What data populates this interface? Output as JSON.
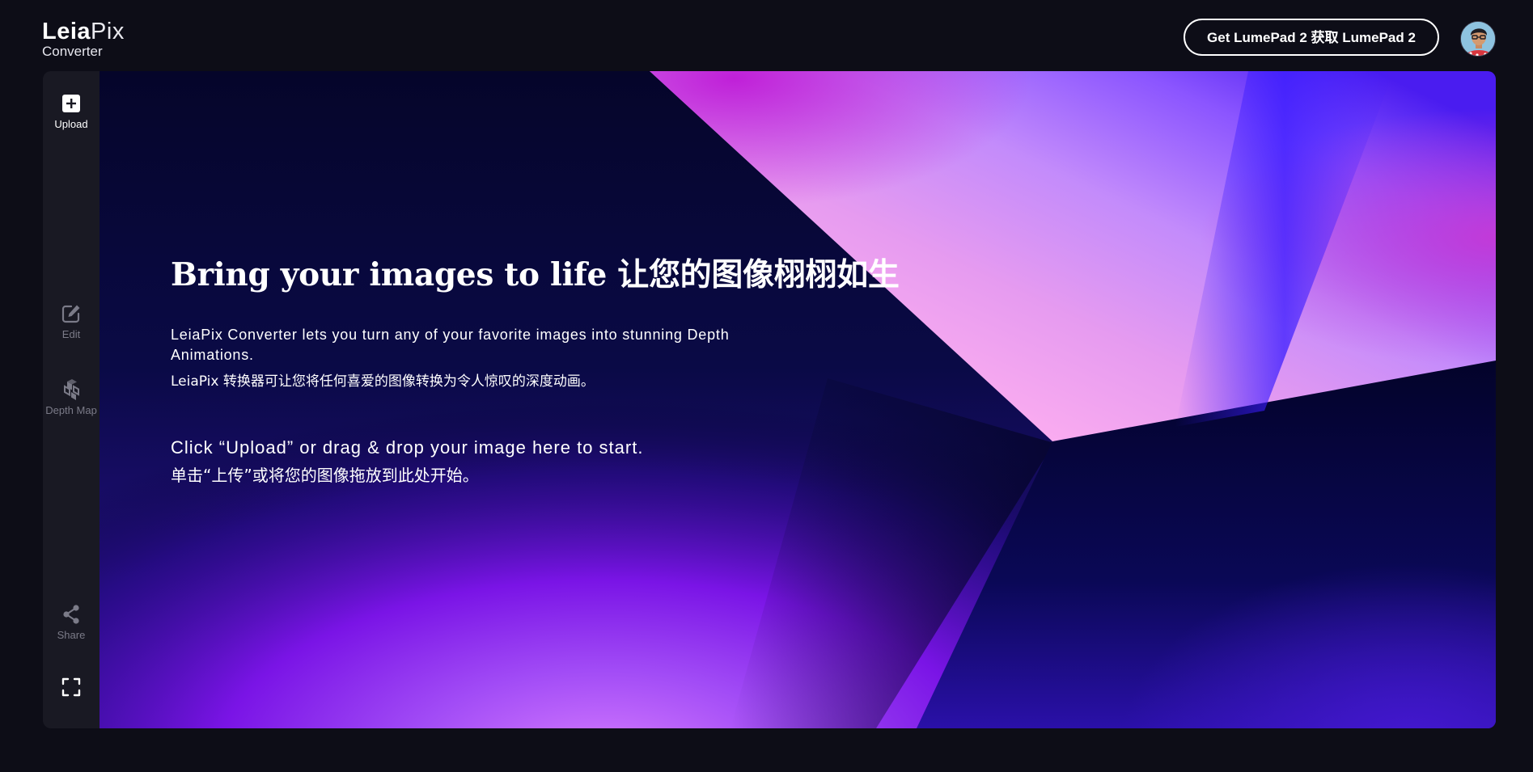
{
  "header": {
    "logo_primary": "Leia",
    "logo_secondary": "Pix",
    "logo_subtitle": "Converter",
    "cta_button_label": "Get LumePad 2 获取 LumePad 2",
    "avatar_icon": "user-avatar"
  },
  "sidebar": {
    "upload": {
      "label": "Upload",
      "icon": "plus-square-icon"
    },
    "edit": {
      "label": "Edit",
      "icon": "edit-icon"
    },
    "depth_map": {
      "label": "Depth Map",
      "icon": "depth-layers-icon"
    },
    "share": {
      "label": "Share",
      "icon": "share-icon"
    },
    "fullscreen": {
      "icon": "fullscreen-icon"
    }
  },
  "hero": {
    "title": "Bring your images to life 让您的图像栩栩如生",
    "description": "LeiaPix Converter lets you turn any of your favorite images into stunning Depth Animations.",
    "description_cn": "LeiaPix 转换器可让您将任何喜爱的图像转换为令人惊叹的深度动画。",
    "cta": "Click “Upload” or drag & drop your image here to start.",
    "cta_cn": "单击“上传”或将您的图像拖放到此处开始。"
  },
  "colors": {
    "page_background": "#0d0d17",
    "sidebar_background": "#191923",
    "accent_purple": "#8a1bf0",
    "accent_pink": "#f7a3ea",
    "deep_navy": "#05052c"
  }
}
